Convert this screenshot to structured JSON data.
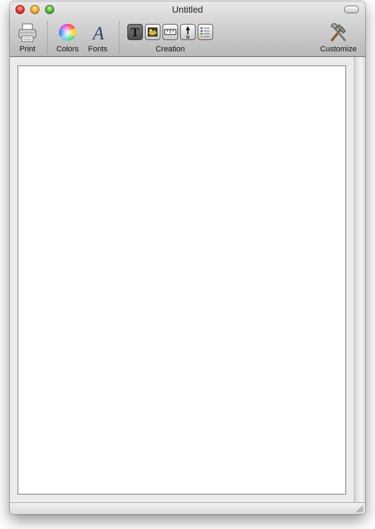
{
  "window": {
    "title": "Untitled"
  },
  "toolbar": {
    "print": {
      "label": "Print",
      "icon": "printer-icon"
    },
    "colors": {
      "label": "Colors",
      "icon": "color-wheel-icon"
    },
    "fonts": {
      "label": "Fonts",
      "icon": "font-icon"
    },
    "creation": {
      "label": "Creation",
      "tools": [
        {
          "icon": "text-tool-icon",
          "glyph": "T",
          "selected": true
        },
        {
          "icon": "image-tool-icon",
          "selected": false
        },
        {
          "icon": "scale-bar-tool-icon",
          "selected": false
        },
        {
          "icon": "north-arrow-tool-icon",
          "glyph": "N",
          "selected": false
        },
        {
          "icon": "legend-tool-icon",
          "selected": false
        }
      ]
    },
    "customize": {
      "label": "Customize",
      "icon": "tools-icon"
    }
  },
  "colors": {
    "titlebar_top": "#e9e9e9",
    "titlebar_bottom": "#b9b9b9",
    "page": "#ffffff",
    "canvas": "#ececec"
  }
}
